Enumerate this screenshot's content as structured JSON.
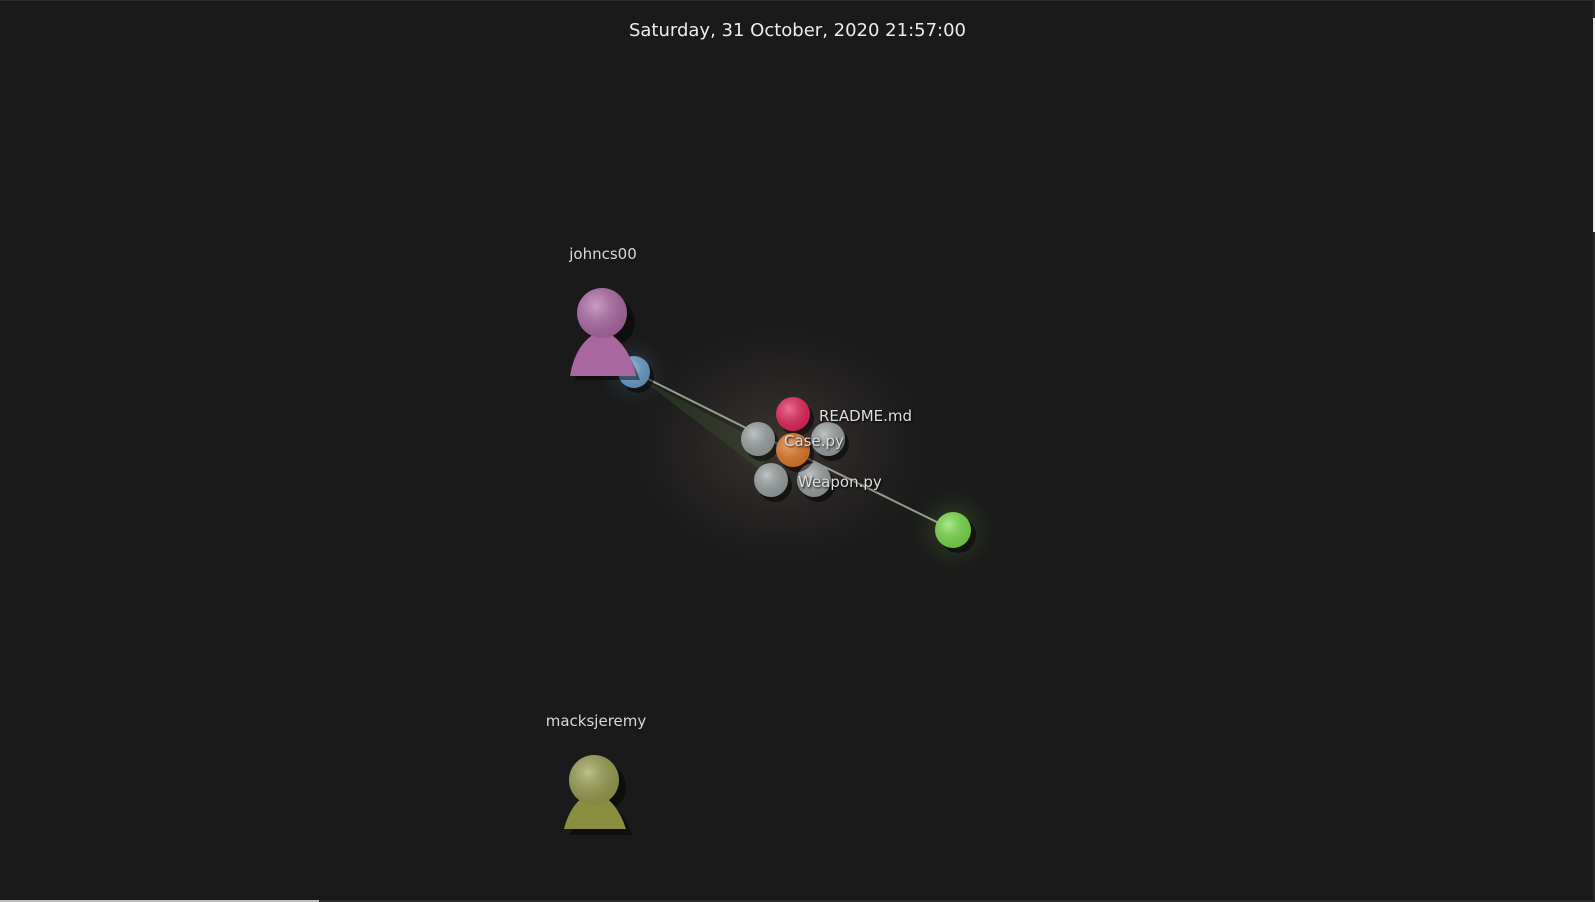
{
  "header": {
    "date_time": "Saturday, 31 October, 2020 21:57:00"
  },
  "users": [
    {
      "name": "johncs00",
      "color": "#b06aa8"
    },
    {
      "name": "macksjeremy",
      "color": "#9aa04e"
    }
  ],
  "files": [
    {
      "name": "README.md",
      "color": "#e8245a"
    },
    {
      "name": "Case.py",
      "color": "#e67a26"
    },
    {
      "name": "Weapon.py",
      "color": "#9da4a4"
    }
  ],
  "colors": {
    "background": "#1a1a1a",
    "dir_node_blue": "#6a9fd0",
    "file_node_green": "#7be04a",
    "file_node_grey": "#9da4a4",
    "edge": "#b8c9b0"
  },
  "timeline": {
    "progress": 0.2
  }
}
